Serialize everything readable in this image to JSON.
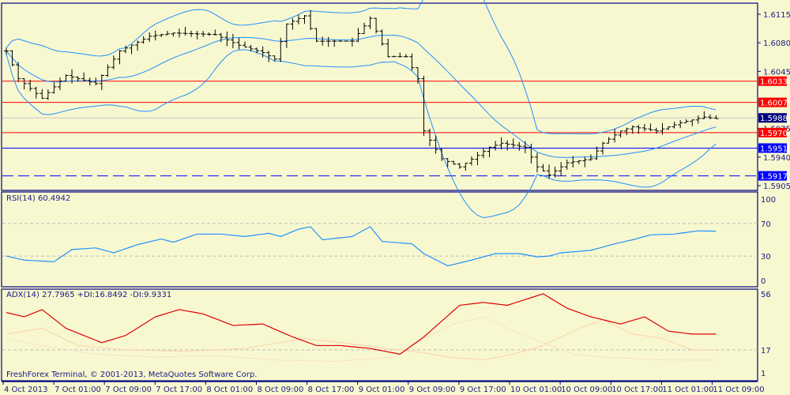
{
  "footer": "FreshForex Terminal, © 2001-2013, MetaQuotes Software Corp.",
  "colors": {
    "bg": "#f8f8d0",
    "axis": "#000080",
    "bands": "#1e90ff",
    "red_line": "#ff0000",
    "blue_line": "#0000ff",
    "rsi": "#1e90ff",
    "adx": "#e00000",
    "plus_di": "#ffd0b0",
    "minus_di": "#f5e0c8"
  },
  "chart_data": [
    {
      "type": "line",
      "title": "Price (OHLC bars with Bollinger Bands)",
      "y_ticks": [
        "1.6115",
        "1.6080",
        "1.6045",
        "1.5975",
        "1.5940",
        "1.5905"
      ],
      "ylim": [
        1.59,
        1.613
      ],
      "price_tags": [
        {
          "label": "1.6033",
          "value": 1.6033,
          "color": "#ff0000",
          "line": "solid"
        },
        {
          "label": "1.6007",
          "value": 1.6007,
          "color": "#ff0000",
          "line": "solid"
        },
        {
          "label": "1.5988",
          "value": 1.5988,
          "color": "#000080",
          "line": "grey"
        },
        {
          "label": "1.5970",
          "value": 1.597,
          "color": "#ff0000",
          "line": "solid"
        },
        {
          "label": "1.5951",
          "value": 1.5951,
          "color": "#0000ff",
          "line": "solid"
        },
        {
          "label": "1.5917",
          "value": 1.5917,
          "color": "#0000ff",
          "line": "dashed"
        }
      ],
      "close_keypoints": [
        [
          0,
          1.607
        ],
        [
          2,
          1.6036
        ],
        [
          6,
          1.6012
        ],
        [
          10,
          1.604
        ],
        [
          15,
          1.603
        ],
        [
          19,
          1.607
        ],
        [
          24,
          1.6088
        ],
        [
          28,
          1.6092
        ],
        [
          35,
          1.609
        ],
        [
          39,
          1.6077
        ],
        [
          43,
          1.6068
        ],
        [
          45,
          1.606
        ],
        [
          47,
          1.6103
        ],
        [
          50,
          1.6113
        ],
        [
          52,
          1.6082
        ],
        [
          58,
          1.6082
        ],
        [
          61,
          1.611
        ],
        [
          64,
          1.6063
        ],
        [
          67,
          1.6063
        ],
        [
          69,
          1.6036
        ],
        [
          70,
          1.5972
        ],
        [
          73,
          1.5938
        ],
        [
          76,
          1.5928
        ],
        [
          79,
          1.5942
        ],
        [
          81,
          1.5952
        ],
        [
          83,
          1.5957
        ],
        [
          87,
          1.5952
        ],
        [
          89,
          1.5928
        ],
        [
          91,
          1.5918
        ],
        [
          94,
          1.5933
        ],
        [
          98,
          1.5938
        ],
        [
          100,
          1.5957
        ],
        [
          103,
          1.5972
        ],
        [
          105,
          1.5977
        ],
        [
          109,
          1.5972
        ],
        [
          113,
          1.5982
        ],
        [
          117,
          1.5989
        ],
        [
          119,
          1.5987
        ]
      ]
    },
    {
      "type": "line",
      "title": "RSI(14) 60.4942",
      "y_ticks": [
        "100",
        "70",
        "30",
        "0"
      ],
      "ylim": [
        0,
        100
      ],
      "levels": [
        70,
        30
      ],
      "keypoints": [
        [
          0,
          30
        ],
        [
          3,
          25
        ],
        [
          8,
          23
        ],
        [
          11,
          38
        ],
        [
          15,
          40
        ],
        [
          18,
          34
        ],
        [
          22,
          44
        ],
        [
          26,
          51
        ],
        [
          28,
          47
        ],
        [
          32,
          57
        ],
        [
          36,
          57
        ],
        [
          40,
          54
        ],
        [
          44,
          58
        ],
        [
          46,
          54
        ],
        [
          49,
          63
        ],
        [
          51,
          66
        ],
        [
          53,
          50
        ],
        [
          58,
          54
        ],
        [
          61,
          66
        ],
        [
          63,
          48
        ],
        [
          68,
          45
        ],
        [
          70,
          33
        ],
        [
          74,
          18
        ],
        [
          78,
          25
        ],
        [
          82,
          33
        ],
        [
          86,
          33
        ],
        [
          89,
          29
        ],
        [
          91,
          30
        ],
        [
          93,
          34
        ],
        [
          98,
          37
        ],
        [
          102,
          45
        ],
        [
          105,
          50
        ],
        [
          108,
          56
        ],
        [
          112,
          57
        ],
        [
          116,
          61
        ],
        [
          119,
          60.5
        ]
      ]
    },
    {
      "type": "line",
      "title": "ADX(14) 27.7965 +DI:16.8492 -DI:9.9331",
      "y_ticks": [
        "56",
        "17",
        "1"
      ],
      "ylim": [
        1,
        56
      ],
      "levels": [
        17
      ],
      "series": [
        {
          "name": "ADX",
          "keypoints": [
            [
              0,
              43
            ],
            [
              3,
              40
            ],
            [
              6,
              45
            ],
            [
              10,
              32
            ],
            [
              16,
              22
            ],
            [
              20,
              27
            ],
            [
              25,
              40
            ],
            [
              29,
              45
            ],
            [
              33,
              42
            ],
            [
              38,
              34
            ],
            [
              43,
              35
            ],
            [
              48,
              26
            ],
            [
              52,
              20
            ],
            [
              56,
              20
            ],
            [
              61,
              18
            ],
            [
              66,
              14
            ],
            [
              70,
              26
            ],
            [
              76,
              48
            ],
            [
              80,
              50
            ],
            [
              84,
              48
            ],
            [
              90,
              56
            ],
            [
              94,
              46
            ],
            [
              98,
              40
            ],
            [
              103,
              35
            ],
            [
              107,
              40
            ],
            [
              111,
              30
            ],
            [
              115,
              28
            ],
            [
              119,
              28
            ]
          ]
        },
        {
          "name": "+DI",
          "keypoints": [
            [
              0,
              28
            ],
            [
              6,
              32
            ],
            [
              12,
              20
            ],
            [
              20,
              17
            ],
            [
              30,
              16
            ],
            [
              40,
              18
            ],
            [
              50,
              25
            ],
            [
              60,
              20
            ],
            [
              70,
              15
            ],
            [
              74,
              12
            ],
            [
              80,
              10
            ],
            [
              85,
              14
            ],
            [
              90,
              20
            ],
            [
              95,
              30
            ],
            [
              100,
              38
            ],
            [
              105,
              28
            ],
            [
              110,
              25
            ],
            [
              115,
              17
            ],
            [
              119,
              16.8
            ]
          ]
        },
        {
          "name": "-DI",
          "keypoints": [
            [
              0,
              25
            ],
            [
              6,
              20
            ],
            [
              15,
              14
            ],
            [
              25,
              12
            ],
            [
              35,
              13
            ],
            [
              45,
              10
            ],
            [
              55,
              9
            ],
            [
              65,
              12
            ],
            [
              70,
              25
            ],
            [
              75,
              35
            ],
            [
              80,
              40
            ],
            [
              85,
              30
            ],
            [
              90,
              22
            ],
            [
              95,
              14
            ],
            [
              100,
              12
            ],
            [
              110,
              10
            ],
            [
              119,
              9.9
            ]
          ]
        }
      ]
    }
  ],
  "x_labels": [
    "4 Oct 2013",
    "7 Oct 01:00",
    "7 Oct 09:00",
    "7 Oct 17:00",
    "8 Oct 01:00",
    "8 Oct 09:00",
    "8 Oct 17:00",
    "9 Oct 01:00",
    "9 Oct 09:00",
    "9 Oct 17:00",
    "10 Oct 01:00",
    "10 Oct 09:00",
    "10 Oct 17:00",
    "11 Oct 01:00",
    "11 Oct 09:00"
  ]
}
